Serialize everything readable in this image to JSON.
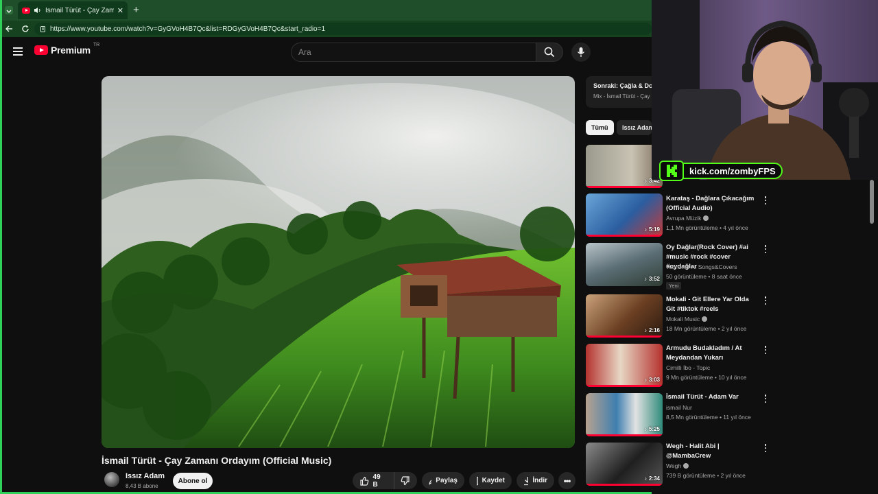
{
  "browser": {
    "tab_title": "İsmail Türüt - Çay Zamanı Ord",
    "url": "https://www.youtube.com/watch?v=GyGVoH4B7Qc&list=RDGyGVoH4B7Qc&start_radio=1"
  },
  "masthead": {
    "logo_text": "Premium",
    "country_code": "TR",
    "search_placeholder": "Ara"
  },
  "video": {
    "title": "İsmail Türüt - Çay Zamanı Ordayım (Official Music)",
    "channel": "Issız Adam",
    "subscribers": "8,43 B abone",
    "subscribe_label": "Abone ol",
    "likes": "49 B",
    "share_label": "Paylaş",
    "save_label": "Kaydet",
    "download_label": "İndir"
  },
  "up_next": {
    "title": "Sonraki: Çağla & Doğ",
    "subtitle": "Mix - İsmail Türüt - Çay Z"
  },
  "chips": [
    "Tümü",
    "Issız Adam"
  ],
  "playlist": [
    {
      "duration": "3:42"
    },
    {
      "title": "Karataş - Dağlara Çıkacağım (Official Audio)",
      "channel": "Avrupa Müzik",
      "verified": true,
      "meta": "1,1 Mn görüntüleme • 4 yıl önce",
      "duration": "5:19"
    },
    {
      "title": "Oy Dağlar(Rock Cover) #ai #music #rock #cover #oydağlar",
      "channel": "Tebrizmir AI Songs&Covers",
      "verified": false,
      "meta": "50 görüntüleme • 8 saat önce",
      "badge": "Yeni",
      "duration": "3:52"
    },
    {
      "title": "Mokali - Git Ellere Yar Olda Git #tiktok #reels",
      "channel": "Mokali Music",
      "verified": true,
      "meta": "18 Mn görüntüleme • 2 yıl önce",
      "duration": "2:16"
    },
    {
      "title": "Armudu Budakladım / At Meydandan Yukarı",
      "channel": "Cimilli İbo - Topic",
      "verified": false,
      "meta": "9 Mn görüntüleme • 10 yıl önce",
      "duration": "3:03"
    },
    {
      "title": "İsmail Türüt - Adam Var",
      "channel": "ismail Nur",
      "verified": false,
      "meta": "8,5 Mn görüntüleme • 11 yıl önce",
      "duration": "5:25"
    },
    {
      "title": "Wegh - Halit Abi | @MambaCrew",
      "channel": "Wegh",
      "verified": true,
      "meta": "739 B görüntüleme • 2 yıl önce",
      "duration": "2:34"
    }
  ],
  "overlay": {
    "kick_url": "kick.com/zombyFPS"
  },
  "colors": {
    "accent": "#ff0033",
    "kick_green": "#53fc18",
    "browser_green": "#1f4f2a"
  }
}
